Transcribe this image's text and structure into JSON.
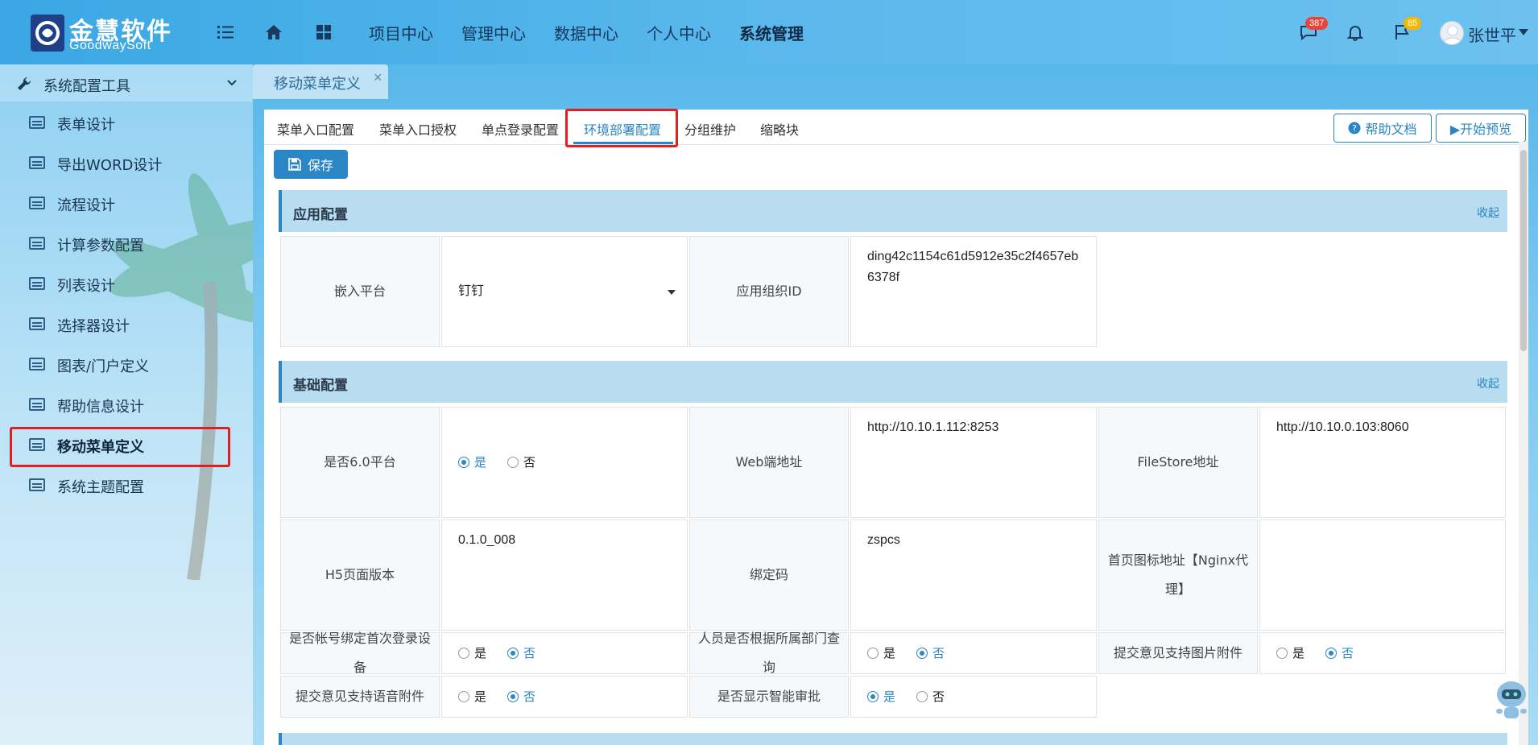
{
  "header": {
    "brand_cn": "金慧软件",
    "brand_en": "GoodwaySoft",
    "nav": [
      "项目中心",
      "管理中心",
      "数据中心",
      "个人中心",
      "系统管理"
    ],
    "messages_badge": "387",
    "flag_badge": "85",
    "user_name": "张世平",
    "colors": {
      "badge_red": "#e8443a",
      "badge_yellow": "#f5b800"
    }
  },
  "sidebar": {
    "title": "系统配置工具",
    "items": [
      "表单设计",
      "导出WORD设计",
      "流程设计",
      "计算参数配置",
      "列表设计",
      "选择器设计",
      "图表/门户定义",
      "帮助信息设计",
      "移动菜单定义",
      "系统主题配置"
    ],
    "active_index": 8
  },
  "tabbar": {
    "tab": "移动菜单定义"
  },
  "subtabs": {
    "items": [
      "菜单入口配置",
      "菜单入口授权",
      "单点登录配置",
      "环境部署配置",
      "分组维护",
      "缩略块"
    ],
    "active": "环境部署配置",
    "help_button": "帮助文档",
    "preview_button": "▶开始预览"
  },
  "toolbar": {
    "save_label": "保存"
  },
  "sections": {
    "app": {
      "title": "应用配置",
      "collapse": "收起",
      "embed_platform_label": "嵌入平台",
      "embed_platform_value": "钉钉",
      "org_id_label": "应用组织ID",
      "org_id_value": "ding42c1154c61d5912e35c2f4657eb6378f"
    },
    "basic": {
      "title": "基础配置",
      "collapse": "收起",
      "is60_label": "是否6.0平台",
      "web_label": "Web端地址",
      "web_value": "http://10.10.1.112:8253",
      "filestore_label": "FileStore地址",
      "filestore_value": "http://10.10.0.103:8060",
      "h5_label": "H5页面版本",
      "h5_value": "0.1.0_008",
      "bind_label": "绑定码",
      "bind_value": "zspcs",
      "nginx_label": "首页图标地址【Nginx代理】",
      "nginx_value": "",
      "device_label": "是否帐号绑定首次登录设备",
      "dept_label": "人员是否根据所属部门查询",
      "img_label": "提交意见支持图片附件",
      "voice_label": "提交意见支持语音附件",
      "smart_label": "是否显示智能审批",
      "yes": "是",
      "no": "否"
    }
  }
}
